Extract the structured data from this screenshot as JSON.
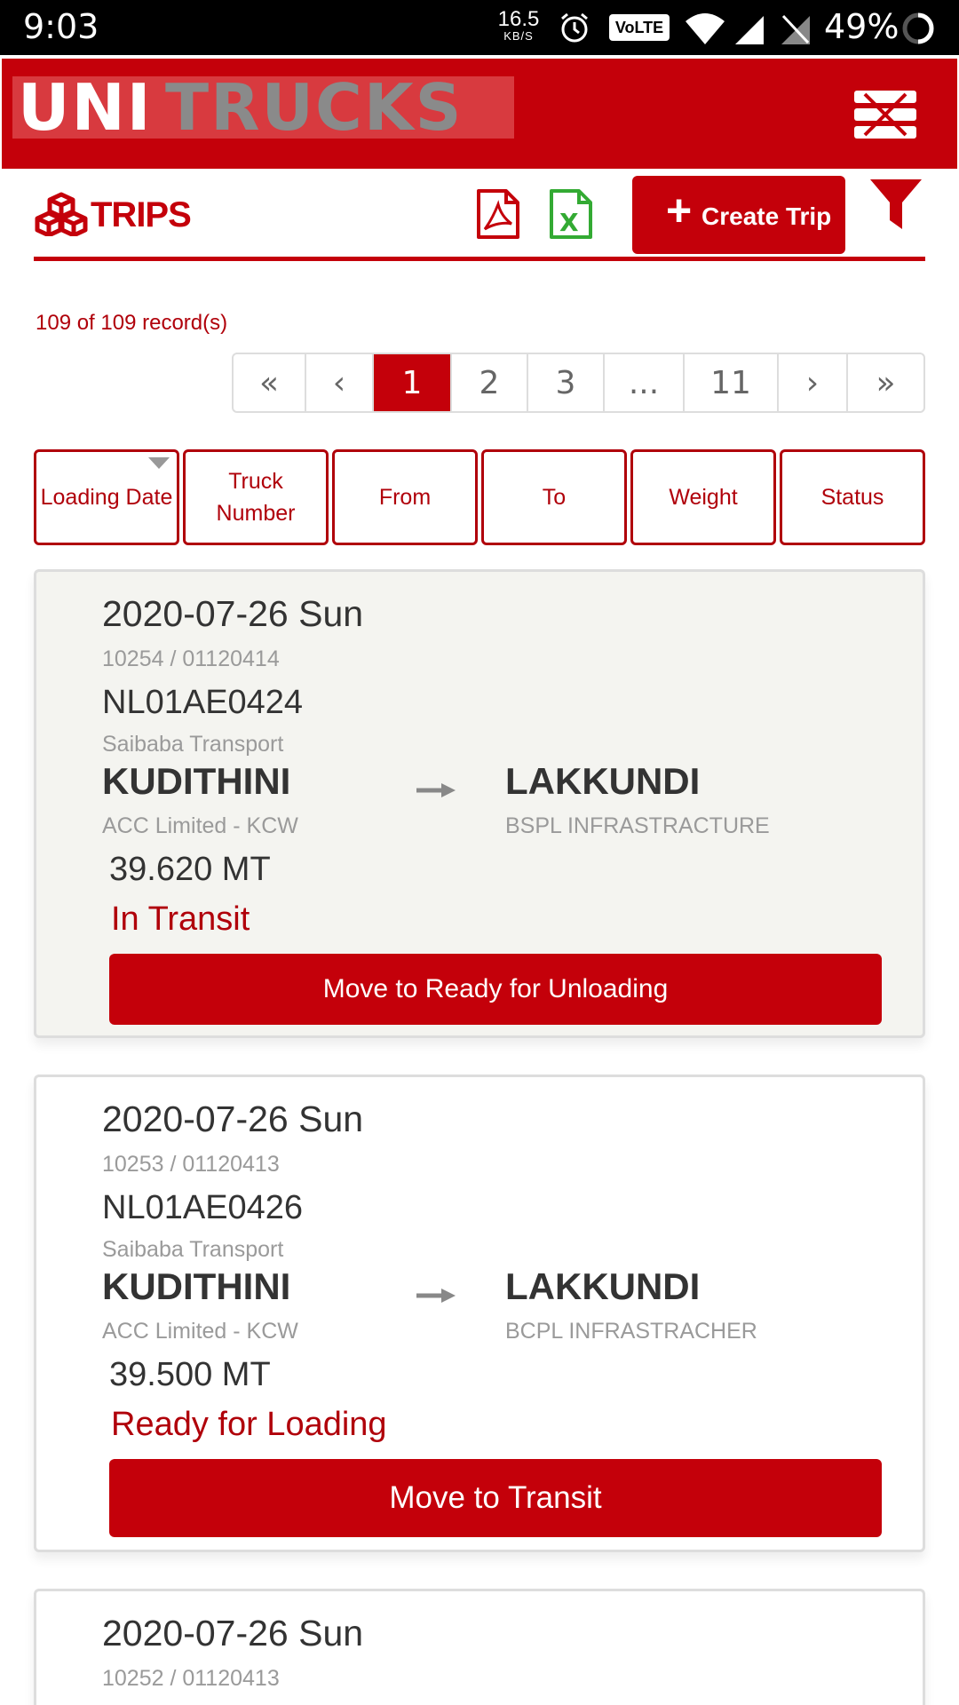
{
  "status_bar": {
    "time": "9:03",
    "net_speed": "16.5",
    "net_unit": "KB/S",
    "volte": "VoLTE",
    "battery": "49%"
  },
  "header": {
    "logo_text": "UNITRUCKS",
    "brand_color": "#c4000a"
  },
  "toolbar": {
    "title": "TRIPS",
    "create_label": "Create Trip",
    "pdf_icon": "pdf-icon",
    "excel_icon": "excel-icon",
    "filter_icon": "filter-icon"
  },
  "records_text": "109 of 109 record(s)",
  "pagination": {
    "first": "«",
    "prev": "‹",
    "pages": [
      "1",
      "2",
      "3",
      "...",
      "11"
    ],
    "current": "1",
    "next": "›",
    "last": "»"
  },
  "sort_headers": [
    "Loading Date",
    "Truck Number",
    "From",
    "To",
    "Weight",
    "Status"
  ],
  "trips": [
    {
      "date": "2020-07-26 Sun",
      "ref": "10254 / 01120414",
      "truck": "NL01AE0424",
      "transporter": "Saibaba Transport",
      "from": "KUDITHINI",
      "consignor": "ACC Limited - KCW",
      "to": "LAKKUNDI",
      "consignee": "BSPL INFRASTRACTURE",
      "weight": "39.620 MT",
      "status": "In Transit",
      "action": "Move to Ready for Unloading"
    },
    {
      "date": "2020-07-26 Sun",
      "ref": "10253 / 01120413",
      "truck": "NL01AE0426",
      "transporter": "Saibaba Transport",
      "from": "KUDITHINI",
      "consignor": "ACC Limited - KCW",
      "to": "LAKKUNDI",
      "consignee": "BCPL INFRASTRACHER",
      "weight": "39.500 MT",
      "status": "Ready for Loading",
      "action": "Move to Transit"
    },
    {
      "date": "2020-07-26 Sun",
      "ref": "10252 / 01120413"
    }
  ]
}
